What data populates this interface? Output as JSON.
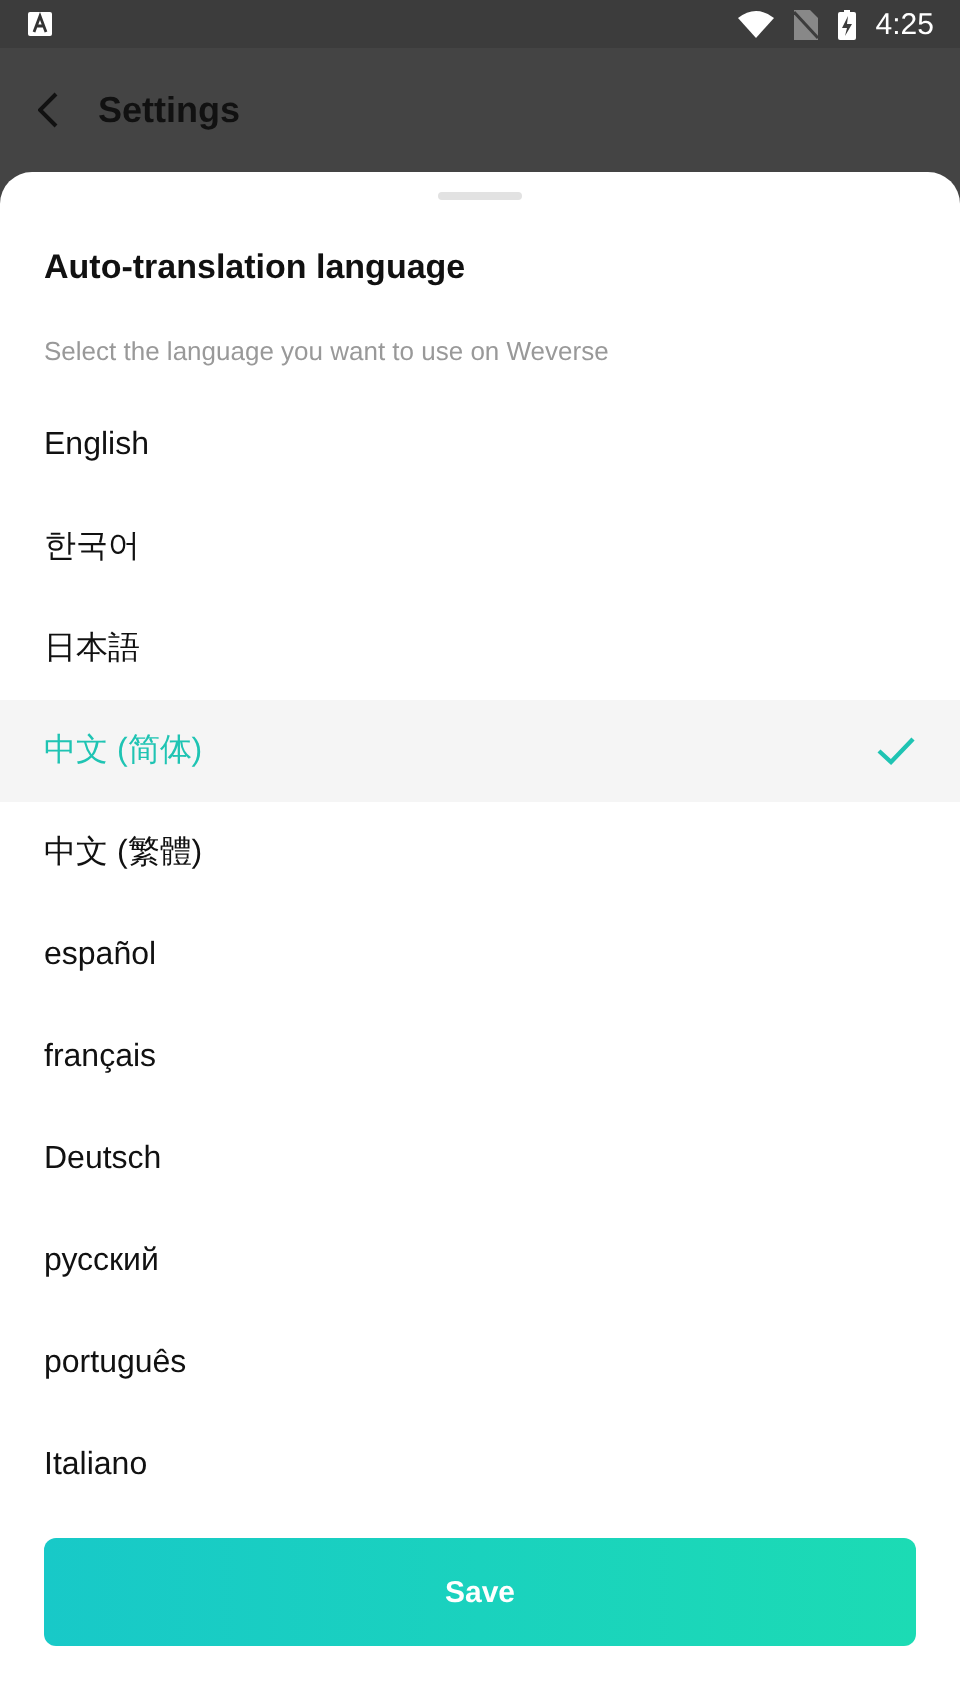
{
  "status_bar": {
    "time": "4:25"
  },
  "app_bar": {
    "title": "Settings"
  },
  "sheet": {
    "title": "Auto-translation language",
    "subtitle": "Select the language you want to use on Weverse",
    "languages": [
      {
        "label": "English",
        "selected": false
      },
      {
        "label": "한국어",
        "selected": false
      },
      {
        "label": "日本語",
        "selected": false
      },
      {
        "label": "中文 (简体)",
        "selected": true
      },
      {
        "label": "中文 (繁體)",
        "selected": false
      },
      {
        "label": "español",
        "selected": false
      },
      {
        "label": "français",
        "selected": false
      },
      {
        "label": "Deutsch",
        "selected": false
      },
      {
        "label": "русский",
        "selected": false
      },
      {
        "label": "português",
        "selected": false
      },
      {
        "label": "Italiano",
        "selected": false
      }
    ],
    "save_button": "Save"
  }
}
